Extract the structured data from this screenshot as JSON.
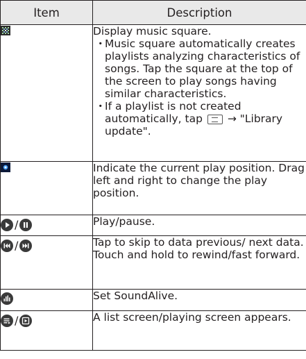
{
  "table": {
    "headers": {
      "item": "Item",
      "description": "Description"
    },
    "rows": [
      {
        "icons": [
          "music-square-icon"
        ],
        "main": "Display music square.",
        "bullets": [
          "Music square automatically creates playlists analyzing characteristics of songs. Tap the square at the top of the screen to play songs having similar characteristics."
        ],
        "bullet2_before": "If a playlist is not created automatically, tap",
        "bullet2_after": "→ \"Library update\"."
      },
      {
        "icons": [
          "play-position-icon"
        ],
        "main": "Indicate the current play position. Drag left and right to change the play position."
      },
      {
        "icons": [
          "play-icon",
          "pause-icon"
        ],
        "separator": "/",
        "main": "Play/pause."
      },
      {
        "icons": [
          "skip-previous-icon",
          "skip-next-icon"
        ],
        "separator": "/",
        "main": "Tap to skip to data previous/ next data. Touch and hold to rewind/fast forward."
      },
      {
        "icons": [
          "soundalive-icon"
        ],
        "main": "Set SoundAlive."
      },
      {
        "icons": [
          "list-screen-icon",
          "playing-screen-icon"
        ],
        "separator": "/",
        "main": "A list screen/playing screen appears."
      }
    ],
    "bullet_glyph": "・"
  },
  "colors": {
    "header_bg": "#e9e9e9",
    "border": "#231f20",
    "icon_dark": "#3a3a3a",
    "position_blue": "#4aa3ff"
  }
}
